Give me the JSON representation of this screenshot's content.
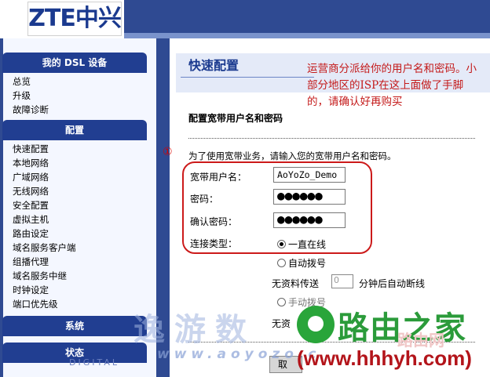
{
  "header": {
    "logo": "ZTE中兴"
  },
  "sidebar": {
    "sections": [
      {
        "title": "我的 DSL 设备",
        "items": [
          "总览",
          "升级",
          "故障诊断"
        ]
      },
      {
        "title": "配置",
        "items": [
          "快速配置",
          "本地网络",
          "广域网络",
          "无线网络",
          "安全配置",
          "虚拟主机",
          "路由设定",
          "域名服务客户端",
          "组播代理",
          "域名服务中继",
          "时钟设定",
          "端口优先级"
        ]
      },
      {
        "title": "系统",
        "items": []
      },
      {
        "title": "状态",
        "items": []
      }
    ],
    "watermark": "DIGITAL"
  },
  "main": {
    "page_title": "快速配置",
    "section_title": "配置宽带用户名和密码",
    "marker": "①",
    "description": "为了使用宽带业务，请输入您的宽带用户名和密码。",
    "form": {
      "username_label": "宽带用户名：",
      "username_value": "AoYoZo_Demo",
      "password_label": "密码：",
      "password_value": "●●●●●●",
      "confirm_label": "确认密码：",
      "confirm_value": "●●●●●●",
      "conn_type_label": "连接类型：",
      "options": [
        "一直在线",
        "自动拨号",
        "手动拨号"
      ],
      "selected_option": "一直在线",
      "idle_prefix": "无资料传送",
      "idle_value": "0",
      "idle_suffix": "分钟后自动断线",
      "idle_prefix_2": "无资"
    },
    "apply_label": "取"
  },
  "annotation": {
    "note": "运营商分派给你的用户名和密码。小部分地区的ISP在这上面做了手脚的，请确认好再购买"
  },
  "watermarks": {
    "cn": "逸游数",
    "url": "www.aoyozo.c"
  },
  "brand": {
    "name": "路由之家",
    "ghost": "路由网",
    "url": "(www.hhhyh.com)"
  }
}
